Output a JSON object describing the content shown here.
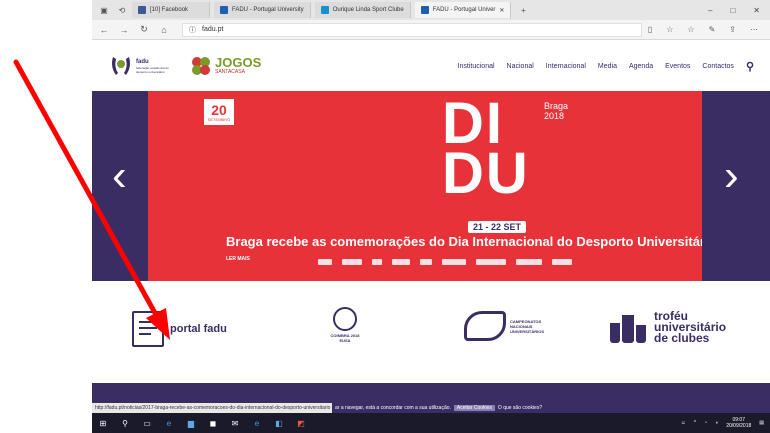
{
  "browser": {
    "tabs": [
      {
        "label": "[10] Facebook",
        "favicon_color": "#3b5998",
        "active": false
      },
      {
        "label": "FADU - Portugal University",
        "favicon_color": "#1a5fb4",
        "active": false
      },
      {
        "label": "Ourique Linda Sport Clube",
        "favicon_color": "#1a8fd0",
        "active": false
      },
      {
        "label": "FADU - Portugal Univer",
        "favicon_color": "#1a5fb4",
        "active": true
      }
    ],
    "url": "fadu.pt",
    "window_controls": [
      "–",
      "□",
      "✕"
    ]
  },
  "site": {
    "logo_fadu": {
      "name": "fadu",
      "tagline": "federação académica do desporto universitário"
    },
    "logo_jogos": {
      "title": "JOGOS",
      "sub": "SANTACASA"
    },
    "menu": [
      "Institucional",
      "Nacional",
      "Internacional",
      "Media",
      "Agenda",
      "Eventos",
      "Contactos"
    ],
    "hero": {
      "badge_number": "20",
      "badge_text": "SETEMBRO",
      "big_text_line1": "DI",
      "big_text_line2": "DU",
      "city": "Braga",
      "year": "2018",
      "dates": "21 - 22 SET",
      "headline": "Braga recebe as comemorações do Dia Internacional do Desporto Universitário",
      "read_more": "LER MAIS"
    },
    "services": {
      "portal": "portal fadu",
      "coimbra": "COIMBRA 2018 EUSA",
      "cnu_lines": [
        "CAMPEONATOS",
        "NACIONAIS",
        "UNIVERSITÁRIOS"
      ],
      "trofeu_lines": [
        "troféu",
        "universitário",
        "de clubes"
      ]
    }
  },
  "status": {
    "hover_url": "http://fadu.pt/noticias/2017-braga-recebe-as-comemoracoes-do-dia-internacional-do-desporto-universitario",
    "cookie_text": "ar a navegar, está a concordar com a sua utilização.",
    "cookie_button": "Aceitar Cookies",
    "cookie_link": "O que são cookies?"
  },
  "taskbar": {
    "time": "09:07",
    "date": "20/09/2018"
  },
  "colors": {
    "brand_purple": "#3a2d63",
    "hero_red": "#e63238",
    "annotation_red": "#ff0000"
  }
}
